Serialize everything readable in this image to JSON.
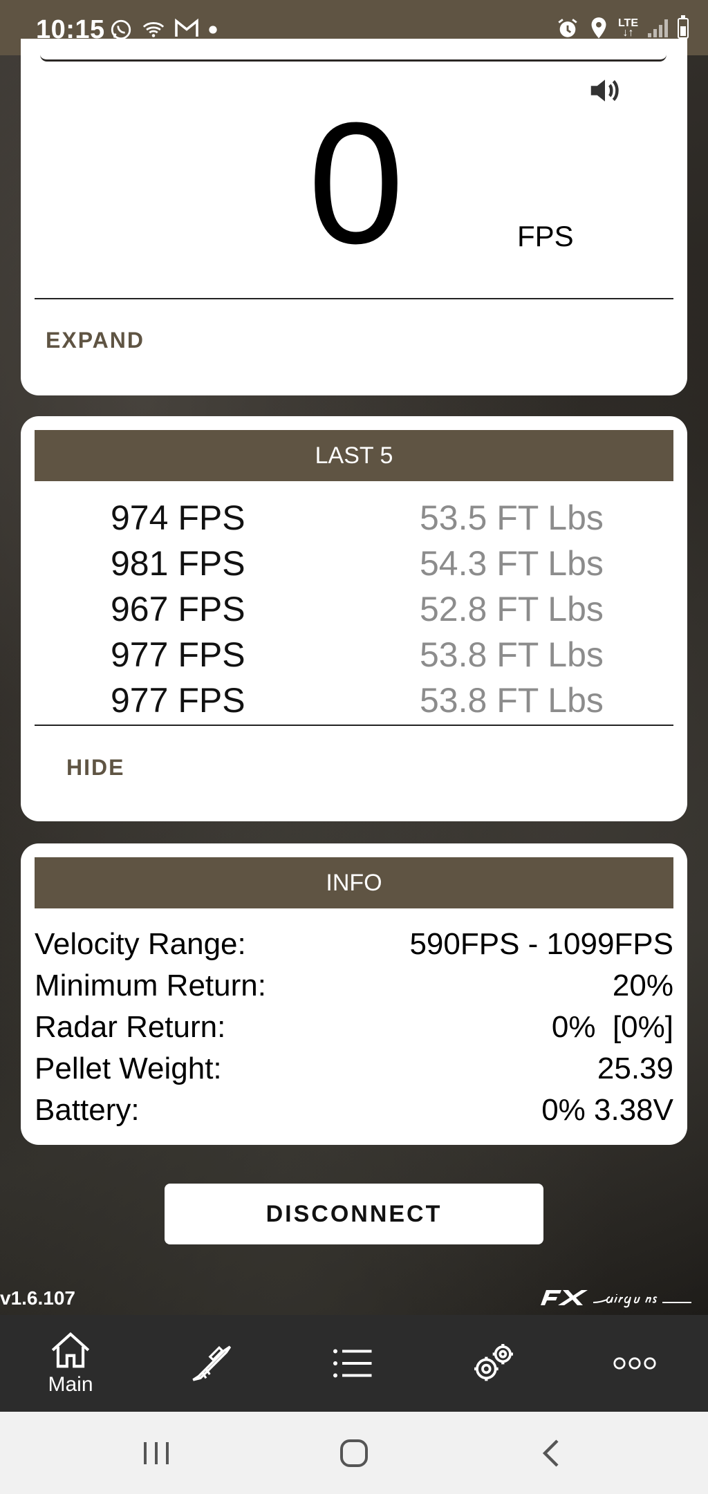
{
  "status_bar": {
    "time": "10:15",
    "icons_left": [
      "whatsapp-icon",
      "wifi-call-icon",
      "gmail-icon",
      "dot-icon"
    ],
    "icons_right": [
      "alarm-icon",
      "location-icon",
      "lte-icon",
      "signal-icon",
      "battery-icon"
    ],
    "lte_label": "LTE"
  },
  "reading": {
    "value": "0",
    "unit": "FPS",
    "sound_icon": "speaker-icon",
    "expand_label": "EXPAND"
  },
  "last5": {
    "title": "LAST 5",
    "shots": [
      {
        "fps": "974 FPS",
        "energy": "53.5 FT Lbs"
      },
      {
        "fps": "981 FPS",
        "energy": "54.3 FT Lbs"
      },
      {
        "fps": "967 FPS",
        "energy": "52.8 FT Lbs"
      },
      {
        "fps": "977 FPS",
        "energy": "53.8 FT Lbs"
      },
      {
        "fps": "977 FPS",
        "energy": "53.8 FT Lbs"
      }
    ],
    "hide_label": "HIDE"
  },
  "info": {
    "title": "INFO",
    "rows": [
      {
        "label": "Velocity Range:",
        "value": "590FPS - 1099FPS"
      },
      {
        "label": "Minimum Return:",
        "value": "20%"
      },
      {
        "label": "Radar Return:",
        "value": "0%  [0%]"
      },
      {
        "label": "Pellet Weight:",
        "value": "25.39"
      },
      {
        "label": "Battery:",
        "value": "0% 3.38V"
      }
    ]
  },
  "disconnect_label": "DISCONNECT",
  "version": "v1.6.107",
  "brand": {
    "logo": "fx-airguns-logo"
  },
  "bottom_nav": {
    "items": [
      {
        "icon": "home-icon",
        "label": "Main"
      },
      {
        "icon": "rifle-icon",
        "label": ""
      },
      {
        "icon": "list-icon",
        "label": ""
      },
      {
        "icon": "gears-icon",
        "label": ""
      },
      {
        "icon": "more-icon",
        "label": ""
      }
    ]
  },
  "colors": {
    "accent": "#5f5443",
    "nav_bg": "#2c2c2c",
    "energy_text": "#8c8c8c"
  }
}
